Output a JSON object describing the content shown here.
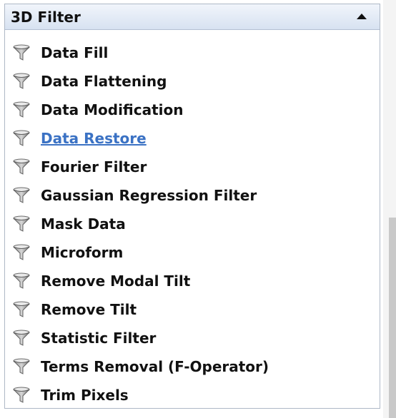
{
  "panel": {
    "title": "3D Filter",
    "collapse_icon": "caret-up-icon",
    "item_icon": "funnel-icon",
    "link_color": "#3b72c4",
    "items": [
      {
        "label": "Data Fill",
        "active": false
      },
      {
        "label": "Data Flattening",
        "active": false
      },
      {
        "label": "Data Modification",
        "active": false
      },
      {
        "label": "Data Restore",
        "active": true
      },
      {
        "label": "Fourier Filter",
        "active": false
      },
      {
        "label": "Gaussian Regression Filter",
        "active": false
      },
      {
        "label": "Mask Data",
        "active": false
      },
      {
        "label": "Microform",
        "active": false
      },
      {
        "label": "Remove Modal Tilt",
        "active": false
      },
      {
        "label": "Remove Tilt",
        "active": false
      },
      {
        "label": "Statistic Filter",
        "active": false
      },
      {
        "label": "Terms Removal (F-Operator)",
        "active": false
      },
      {
        "label": "Trim Pixels",
        "active": false
      }
    ]
  }
}
